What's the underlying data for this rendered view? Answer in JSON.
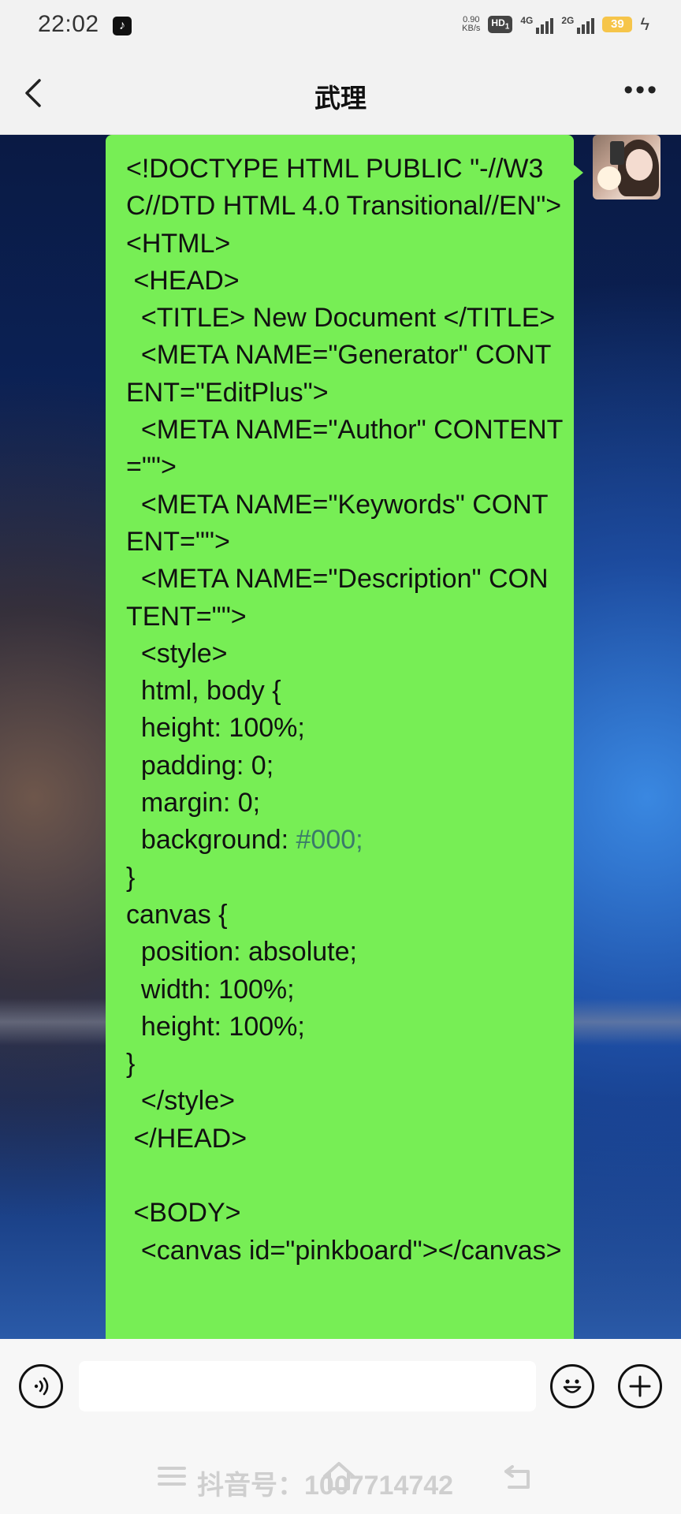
{
  "status_bar": {
    "time": "22:02",
    "net_speed_value": "0.90",
    "net_speed_unit": "KB/s",
    "hd_label": "HD",
    "hd_sub": "1",
    "signal_1_label": "4G",
    "signal_2_label": "2G",
    "battery": "39"
  },
  "header": {
    "title": "武理"
  },
  "message": {
    "code": "<!DOCTYPE HTML PUBLIC \"-//W3C//DTD HTML 4.0 Transitional//EN\">\n<HTML>\n <HEAD>\n  <TITLE> New Document </TITLE>\n  <META NAME=\"Generator\" CONTENT=\"EditPlus\">\n  <META NAME=\"Author\" CONTENT=\"\">\n  <META NAME=\"Keywords\" CONTENT=\"\">\n  <META NAME=\"Description\" CONTENT=\"\">\n  <style>\n  html, body {\n  height: 100%;\n  padding: 0;\n  margin: 0;\n  background: ",
    "code_hex": "#000;",
    "code_rest": "\n}\ncanvas {\n  position: absolute;\n  width: 100%;\n  height: 100%;\n}\n  </style>\n </HEAD>\n\n <BODY>\n  <canvas id=\"pinkboard\"></canvas>",
    "bubble_color": "#77ee55"
  },
  "input": {
    "placeholder": ""
  },
  "watermark": {
    "text": "抖音号：1007714742"
  },
  "icons": {
    "back": "chevron-left-icon",
    "more": "more-horizontal-icon",
    "voice": "voice-icon",
    "emoji": "emoji-icon",
    "plus": "plus-icon",
    "nav_menu": "menu-icon",
    "nav_home": "home-icon",
    "nav_back": "back-icon"
  }
}
